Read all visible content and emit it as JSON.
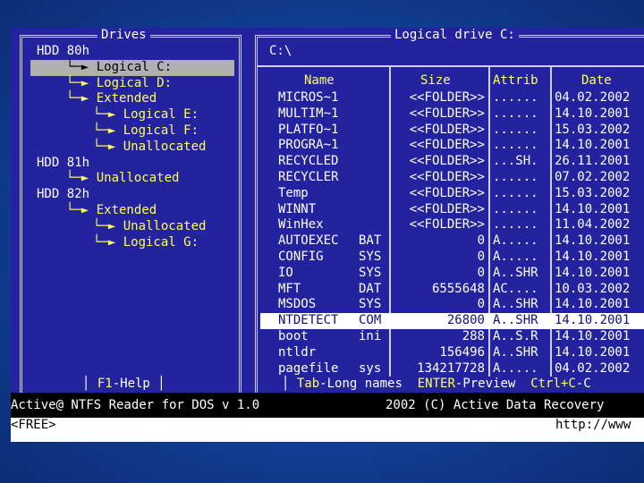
{
  "drives_panel": {
    "title": "Drives",
    "tree": [
      {
        "text": "HDD 80h",
        "indent": 0,
        "color": "white",
        "selected": false
      },
      {
        "text": "└─► Logical C:",
        "indent": 1,
        "color": "yellow",
        "selected": true
      },
      {
        "text": "└─► Logical D:",
        "indent": 1,
        "color": "yellow",
        "selected": false
      },
      {
        "text": "└─► Extended",
        "indent": 1,
        "color": "yellow",
        "selected": false
      },
      {
        "text": "└─► Logical E:",
        "indent": 2,
        "color": "yellow",
        "selected": false
      },
      {
        "text": "└─► Logical F:",
        "indent": 2,
        "color": "yellow",
        "selected": false
      },
      {
        "text": "└─► Unallocated",
        "indent": 2,
        "color": "yellow",
        "selected": false
      },
      {
        "text": "HDD 81h",
        "indent": 0,
        "color": "white",
        "selected": false
      },
      {
        "text": "└─► Unallocated",
        "indent": 1,
        "color": "yellow",
        "selected": false
      },
      {
        "text": "HDD 82h",
        "indent": 0,
        "color": "white",
        "selected": false
      },
      {
        "text": "└─► Extended",
        "indent": 1,
        "color": "yellow",
        "selected": false
      },
      {
        "text": "└─► Unallocated",
        "indent": 2,
        "color": "yellow",
        "selected": false
      },
      {
        "text": "└─► Logical G:",
        "indent": 2,
        "color": "yellow",
        "selected": false
      }
    ],
    "help_key": "F1",
    "help_label": "-Help"
  },
  "files_panel": {
    "title": "Logical drive C:",
    "path": "C:\\",
    "columns": [
      "Name",
      "Size",
      "Attrib",
      "Date"
    ],
    "rows": [
      {
        "name": "MICROS~1",
        "ext": "",
        "size": "<<FOLDER>>",
        "attrib": "......",
        "date": "04.02.2002",
        "selected": false
      },
      {
        "name": "MULTIM~1",
        "ext": "",
        "size": "<<FOLDER>>",
        "attrib": "......",
        "date": "14.10.2001",
        "selected": false
      },
      {
        "name": "PLATFO~1",
        "ext": "",
        "size": "<<FOLDER>>",
        "attrib": "......",
        "date": "15.03.2002",
        "selected": false
      },
      {
        "name": "PROGRA~1",
        "ext": "",
        "size": "<<FOLDER>>",
        "attrib": "......",
        "date": "14.10.2001",
        "selected": false
      },
      {
        "name": "RECYCLED",
        "ext": "",
        "size": "<<FOLDER>>",
        "attrib": "...SH.",
        "date": "26.11.2001",
        "selected": false
      },
      {
        "name": "RECYCLER",
        "ext": "",
        "size": "<<FOLDER>>",
        "attrib": "......",
        "date": "07.02.2002",
        "selected": false
      },
      {
        "name": "Temp",
        "ext": "",
        "size": "<<FOLDER>>",
        "attrib": "......",
        "date": "15.03.2002",
        "selected": false
      },
      {
        "name": "WINNT",
        "ext": "",
        "size": "<<FOLDER>>",
        "attrib": "......",
        "date": "14.10.2001",
        "selected": false
      },
      {
        "name": "WinHex",
        "ext": "",
        "size": "<<FOLDER>>",
        "attrib": "......",
        "date": "11.04.2002",
        "selected": false
      },
      {
        "name": "AUTOEXEC",
        "ext": "BAT",
        "size": "0",
        "attrib": "A.....",
        "date": "14.10.2001",
        "selected": false
      },
      {
        "name": "CONFIG",
        "ext": "SYS",
        "size": "0",
        "attrib": "A.....",
        "date": "14.10.2001",
        "selected": false
      },
      {
        "name": "IO",
        "ext": "SYS",
        "size": "0",
        "attrib": "A..SHR",
        "date": "14.10.2001",
        "selected": false
      },
      {
        "name": "MFT",
        "ext": "DAT",
        "size": "6555648",
        "attrib": "AC....",
        "date": "10.03.2002",
        "selected": false
      },
      {
        "name": "MSDOS",
        "ext": "SYS",
        "size": "0",
        "attrib": "A..SHR",
        "date": "14.10.2001",
        "selected": false
      },
      {
        "name": "NTDETECT",
        "ext": "COM",
        "size": "26800",
        "attrib": "A..SHR",
        "date": "14.10.2001",
        "selected": true
      },
      {
        "name": "boot",
        "ext": "ini",
        "size": "288",
        "attrib": "A..S.R",
        "date": "14.10.2001",
        "selected": false
      },
      {
        "name": "ntldr",
        "ext": "",
        "size": "156496",
        "attrib": "A..SHR",
        "date": "14.10.2001",
        "selected": false
      },
      {
        "name": "pagefile",
        "ext": "sys",
        "size": "134217728",
        "attrib": "A.....",
        "date": "04.02.2002",
        "selected": false
      }
    ],
    "hints": [
      {
        "key": "Tab",
        "label": "-Long names"
      },
      {
        "key": "ENTER",
        "label": "-Preview"
      },
      {
        "key": "Ctrl+C",
        "label": "-C"
      }
    ]
  },
  "status_bar": {
    "app_name": "Active@ NTFS Reader for DOS v 1.0",
    "copyright": "2002 (C) Active Data Recovery"
  },
  "footer": {
    "label": "<FREE>",
    "url": "http://www"
  },
  "colors": {
    "panel_bg": "#2323a0",
    "text_yellow": "#ffff55",
    "text_white": "#ffffff",
    "border": "#d0d0ff",
    "highlight_gray": "#b0b0b0",
    "slide_blue": "#1f56b8"
  }
}
